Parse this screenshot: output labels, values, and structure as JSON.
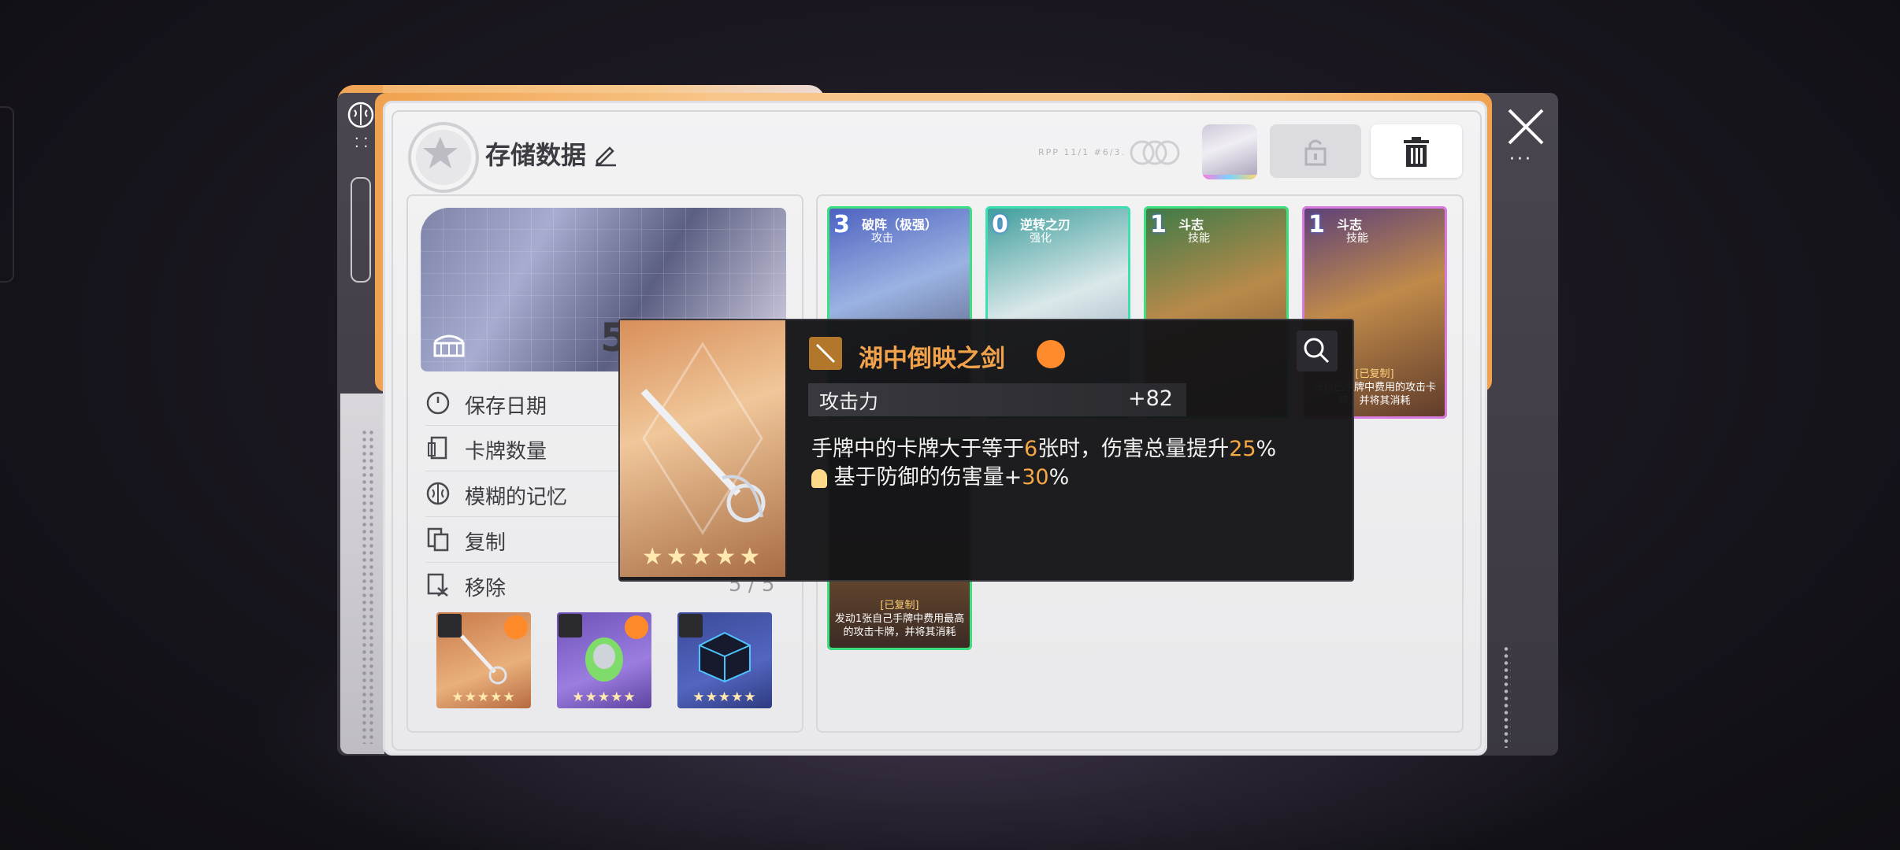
{
  "header": {
    "title": "存储数据",
    "caption": "RPP 11/1 #6/3."
  },
  "info": {
    "hero_number": "5",
    "rows": [
      {
        "label": "保存日期",
        "icon": "clock-icon"
      },
      {
        "label": "卡牌数量",
        "icon": "cards-icon"
      },
      {
        "label": "模糊的记忆",
        "icon": "brain-icon"
      },
      {
        "label": "复制",
        "icon": "copy-icon"
      },
      {
        "label": "移除",
        "icon": "remove-icon"
      }
    ],
    "remove_value": "5 / 5"
  },
  "equipment": [
    {
      "name": "sword",
      "stars": "★★★★★",
      "color": "#c9794a"
    },
    {
      "name": "creature",
      "stars": "★★★★★",
      "color": "#7a58c4"
    },
    {
      "name": "cube",
      "stars": "★★★★★",
      "color": "#3b4a98"
    }
  ],
  "cards": [
    {
      "cost": "3",
      "name": "破阵（极强）",
      "type": "攻击",
      "desc": ""
    },
    {
      "cost": "0",
      "name": "逆转之刃",
      "type": "强化",
      "desc": ""
    },
    {
      "cost": "1",
      "name": "斗志",
      "type": "技能",
      "desc": ""
    },
    {
      "cost": "1",
      "name": "斗志",
      "type": "技能",
      "copied": "[已复制]",
      "desc": "张自己手牌中费用的攻击卡牌，并将其消耗"
    },
    {
      "cost": "",
      "name": "",
      "type": "",
      "copied": "[已复制]",
      "desc": "发动1张自己手牌中费用最高的攻击卡牌，并将其消耗"
    }
  ],
  "tooltip": {
    "name": "湖中倒映之剑",
    "stat_label": "攻击力",
    "stat_value": "+82",
    "line1_a": "手牌中的卡牌大于等于",
    "line1_b": "6",
    "line1_c": "张时，伤害总量提升",
    "line1_d": "25",
    "line1_e": "%",
    "line2_a": "基于防御的伤害量+",
    "line2_b": "30",
    "line2_c": "%",
    "stars": "★★★★★"
  },
  "colors": {
    "accent_orange": "#f6a845",
    "panel": "#f0f0f2",
    "frame_orange": "#f0a24f"
  }
}
